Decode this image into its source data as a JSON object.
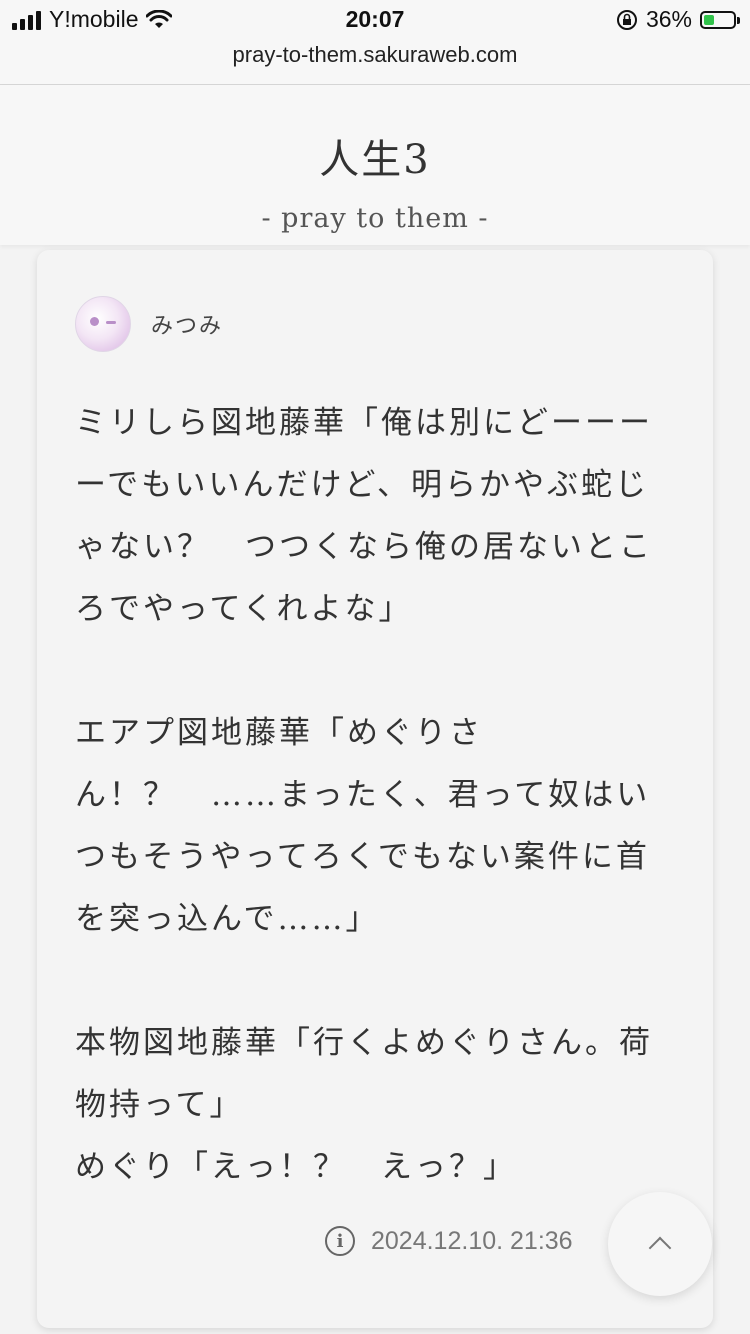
{
  "status_bar": {
    "carrier": "Y!mobile",
    "time": "20:07",
    "battery_percent": "36%",
    "battery_level": 0.36,
    "signal_icon": "signal-bars-icon",
    "wifi_icon": "wifi-icon",
    "lock_icon": "rotation-lock-icon"
  },
  "browser": {
    "url": "pray-to-them.sakuraweb.com"
  },
  "site": {
    "title": "人生3",
    "subtitle": "- pray to them -"
  },
  "post": {
    "author": "みつみ",
    "avatar_icon": "avatar-icon",
    "body": "ミリしら図地藤華「俺は別にどーーーーでもいいんだけど、明らかやぶ蛇じゃない？　つつくなら俺の居ないところでやってくれよな」\n\nエアプ図地藤華「めぐりさん！？　……まったく、君って奴はいつもそうやってろくでもない案件に首を突っ込んで……」\n\n本物図地藤華「行くよめぐりさん。荷物持って」\nめぐり「えっ！？　えっ？」",
    "date": "2024.12.10. 21:36",
    "info_icon": "info-icon"
  },
  "scroll_top": {
    "icon": "chevron-up-icon"
  },
  "colors": {
    "background": "#f3f3f3",
    "card": "#f4f4f4",
    "battery_fill": "#30c24a"
  }
}
